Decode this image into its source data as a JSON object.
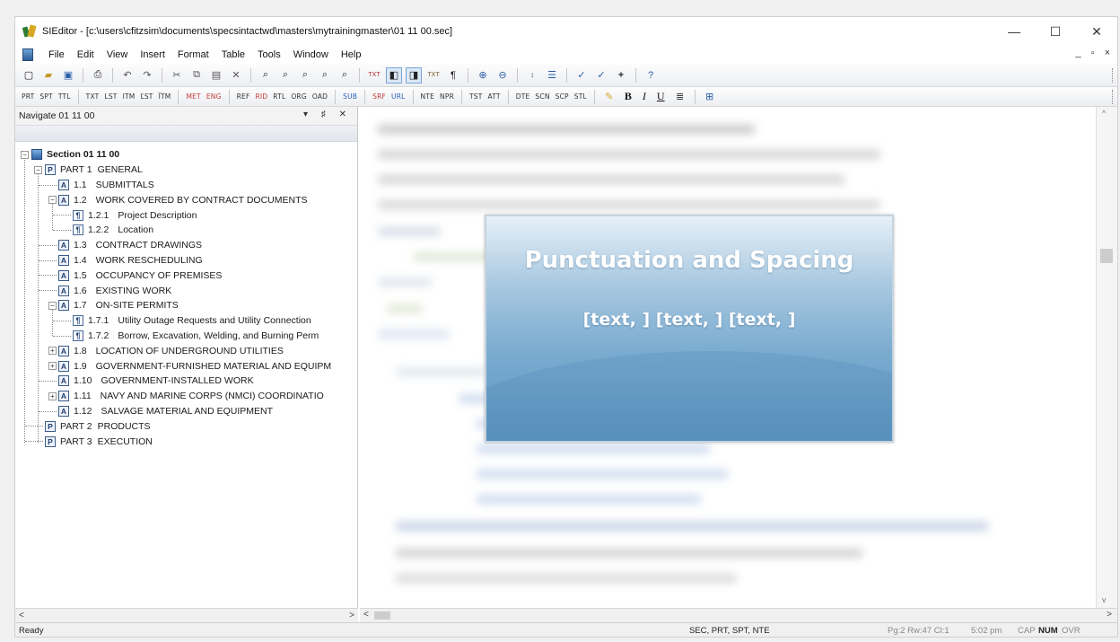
{
  "window": {
    "title": "SIEditor - [c:\\users\\cfitzsim\\documents\\specsintactwd\\masters\\mytrainingmaster\\01 11 00.sec]",
    "minimize": "—",
    "maximize": "☐",
    "close": "✕"
  },
  "menu": {
    "items": [
      "File",
      "Edit",
      "View",
      "Insert",
      "Format",
      "Table",
      "Tools",
      "Window",
      "Help"
    ],
    "mdi_controls": "_ ▫ ×"
  },
  "toolbar_tags": {
    "items": [
      "PRT",
      "SPT",
      "TTL",
      "TXT",
      "LST",
      "ITM",
      "ĽST",
      "ÏTM",
      "MET",
      "ENG",
      "REF",
      "RID",
      "RTL",
      "ORG",
      "OAD",
      "SUB",
      "SRF",
      "URL",
      "NTE",
      "NPR",
      "TST",
      "ATT",
      "DTE",
      "SCN",
      "SCP",
      "STL"
    ],
    "format": [
      "B",
      "I",
      "U"
    ]
  },
  "navigator": {
    "title": "Navigate 01 11 00",
    "controls": "▾ ♯ ✕",
    "tree": [
      {
        "num": "",
        "label": "Section 01 11 00",
        "type": "sec"
      },
      {
        "num": "PART 1",
        "label": "GENERAL",
        "type": "P"
      },
      {
        "num": "1.1",
        "label": "SUBMITTALS",
        "type": "A"
      },
      {
        "num": "1.2",
        "label": "WORK COVERED BY CONTRACT DOCUMENTS",
        "type": "A"
      },
      {
        "num": "1.2.1",
        "label": "Project Description",
        "type": "sub"
      },
      {
        "num": "1.2.2",
        "label": "Location",
        "type": "sub"
      },
      {
        "num": "1.3",
        "label": "CONTRACT DRAWINGS",
        "type": "A"
      },
      {
        "num": "1.4",
        "label": "WORK RESCHEDULING",
        "type": "A"
      },
      {
        "num": "1.5",
        "label": "OCCUPANCY OF PREMISES",
        "type": "A"
      },
      {
        "num": "1.6",
        "label": "EXISTING WORK",
        "type": "A"
      },
      {
        "num": "1.7",
        "label": "ON-SITE PERMITS",
        "type": "A"
      },
      {
        "num": "1.7.1",
        "label": "Utility Outage Requests and Utility Connection",
        "type": "sub"
      },
      {
        "num": "1.7.2",
        "label": "Borrow, Excavation, Welding, and Burning Perm",
        "type": "sub"
      },
      {
        "num": "1.8",
        "label": "LOCATION OF UNDERGROUND UTILITIES",
        "type": "A"
      },
      {
        "num": "1.9",
        "label": "GOVERNMENT-FURNISHED MATERIAL AND EQUIPM",
        "type": "A"
      },
      {
        "num": "1.10",
        "label": "GOVERNMENT-INSTALLED WORK",
        "type": "A"
      },
      {
        "num": "1.11",
        "label": "NAVY AND MARINE CORPS (NMCI) COORDINATIO",
        "type": "A"
      },
      {
        "num": "1.12",
        "label": "SALVAGE MATERIAL AND EQUIPMENT",
        "type": "A"
      },
      {
        "num": "PART 2",
        "label": "PRODUCTS",
        "type": "P"
      },
      {
        "num": "PART 3",
        "label": "EXECUTION",
        "type": "P"
      }
    ]
  },
  "slide": {
    "title": "Punctuation and Spacing",
    "subtitle": "[text, ] [text, ] [text, ]"
  },
  "status": {
    "ready": "Ready",
    "tags": "SEC, PRT, SPT, NTE",
    "position": "Pg:2 Rw:47 Cl:1",
    "time": "5:02 pm",
    "cap": "CAP",
    "num": "NUM",
    "ovr": "OVR"
  }
}
